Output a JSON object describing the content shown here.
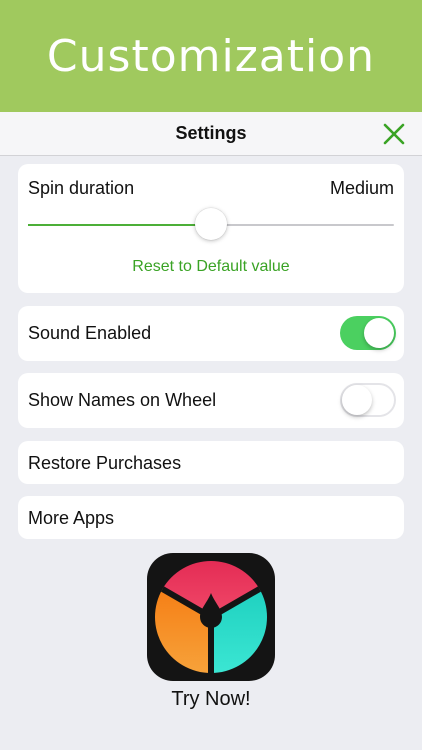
{
  "banner": {
    "title": "Customization"
  },
  "navbar": {
    "title": "Settings",
    "close_icon": "close-x-icon",
    "accent": "#3aa325"
  },
  "spin": {
    "label": "Spin duration",
    "value": "Medium",
    "slider_level": 0.5,
    "reset_label": "Reset to Default value"
  },
  "sound": {
    "label": "Sound Enabled",
    "enabled": true
  },
  "names": {
    "label": "Show Names on Wheel",
    "enabled": false
  },
  "restore": {
    "label": "Restore Purchases"
  },
  "more_apps": {
    "label": "More Apps"
  },
  "promo": {
    "icon": "spinner-wheel-app-icon",
    "label": "Try Now!",
    "wheel_colors": [
      "#e2345a",
      "#f5891e",
      "#25d6c4"
    ]
  },
  "colors": {
    "banner": "#a0c95e",
    "toggle_on": "#4bd060",
    "slider_fill": "#4caf38",
    "link": "#3aa325"
  }
}
